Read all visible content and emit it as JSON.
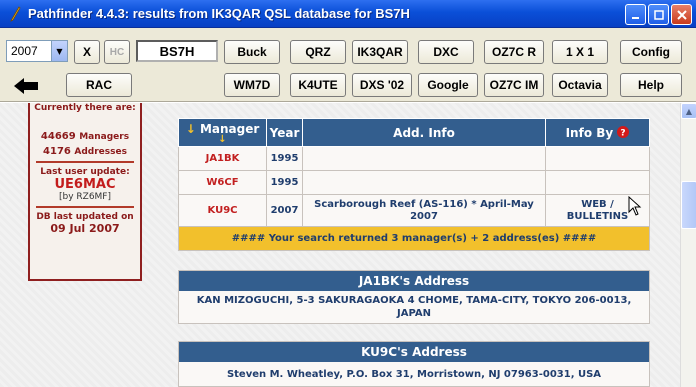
{
  "window": {
    "title": "Pathfinder 4.4.3: results from IK3QAR QSL database for BS7H"
  },
  "toolbar": {
    "year_value": "2007",
    "x_label": "X",
    "hc_label": "HC",
    "callsign_value": "BS7H",
    "buttons_row1": [
      "Buck",
      "QRZ",
      "IK3QAR",
      "DXC",
      "OZ7C R",
      "1 X 1",
      "Config"
    ],
    "buttons_row2": [
      "RAC",
      "WM7D",
      "K4UTE",
      "DXS '02",
      "Google",
      "OZ7C IM",
      "Octavia",
      "Help"
    ]
  },
  "sidebar": {
    "currently": "Currently there are:",
    "managers_count": "44669",
    "managers_label": "Managers",
    "addresses_count": "4176",
    "addresses_label": "Addresses",
    "last_update_label": "Last user update:",
    "last_user": "UE6MAC",
    "by_note": "[by RZ6MF]",
    "db_updated_label": "DB last updated on",
    "db_updated_date": "09 Jul 2007"
  },
  "results": {
    "headers": {
      "manager": "Manager",
      "year": "Year",
      "info": "Add. Info",
      "info_by": "Info By"
    },
    "rows": [
      {
        "manager": "JA1BK",
        "year": "1995",
        "info": "",
        "by": ""
      },
      {
        "manager": "W6CF",
        "year": "1995",
        "info": "",
        "by": ""
      },
      {
        "manager": "KU9C",
        "year": "2007",
        "info": "Scarborough Reef (AS-116) * April-May 2007",
        "by": "WEB / BULLETINS"
      }
    ],
    "summary": "####  Your search returned 3 manager(s) + 2 address(es)  ####"
  },
  "addresses": [
    {
      "title": "JA1BK's Address",
      "body": "KAN MIZOGUCHI, 5-3 SAKURAGAOKA 4 CHOME, TAMA-CITY, TOKYO 206-0013, JAPAN"
    },
    {
      "title": "KU9C's Address",
      "body": "Steven M. Wheatley, P.O. Box 31, Morristown, NJ 07963-0031, USA"
    }
  ],
  "colors": {
    "titlebar": "#0a4fd8",
    "table_header": "#335e8e",
    "manager_red": "#c21f1f",
    "summary_bg": "#f2c02c"
  }
}
